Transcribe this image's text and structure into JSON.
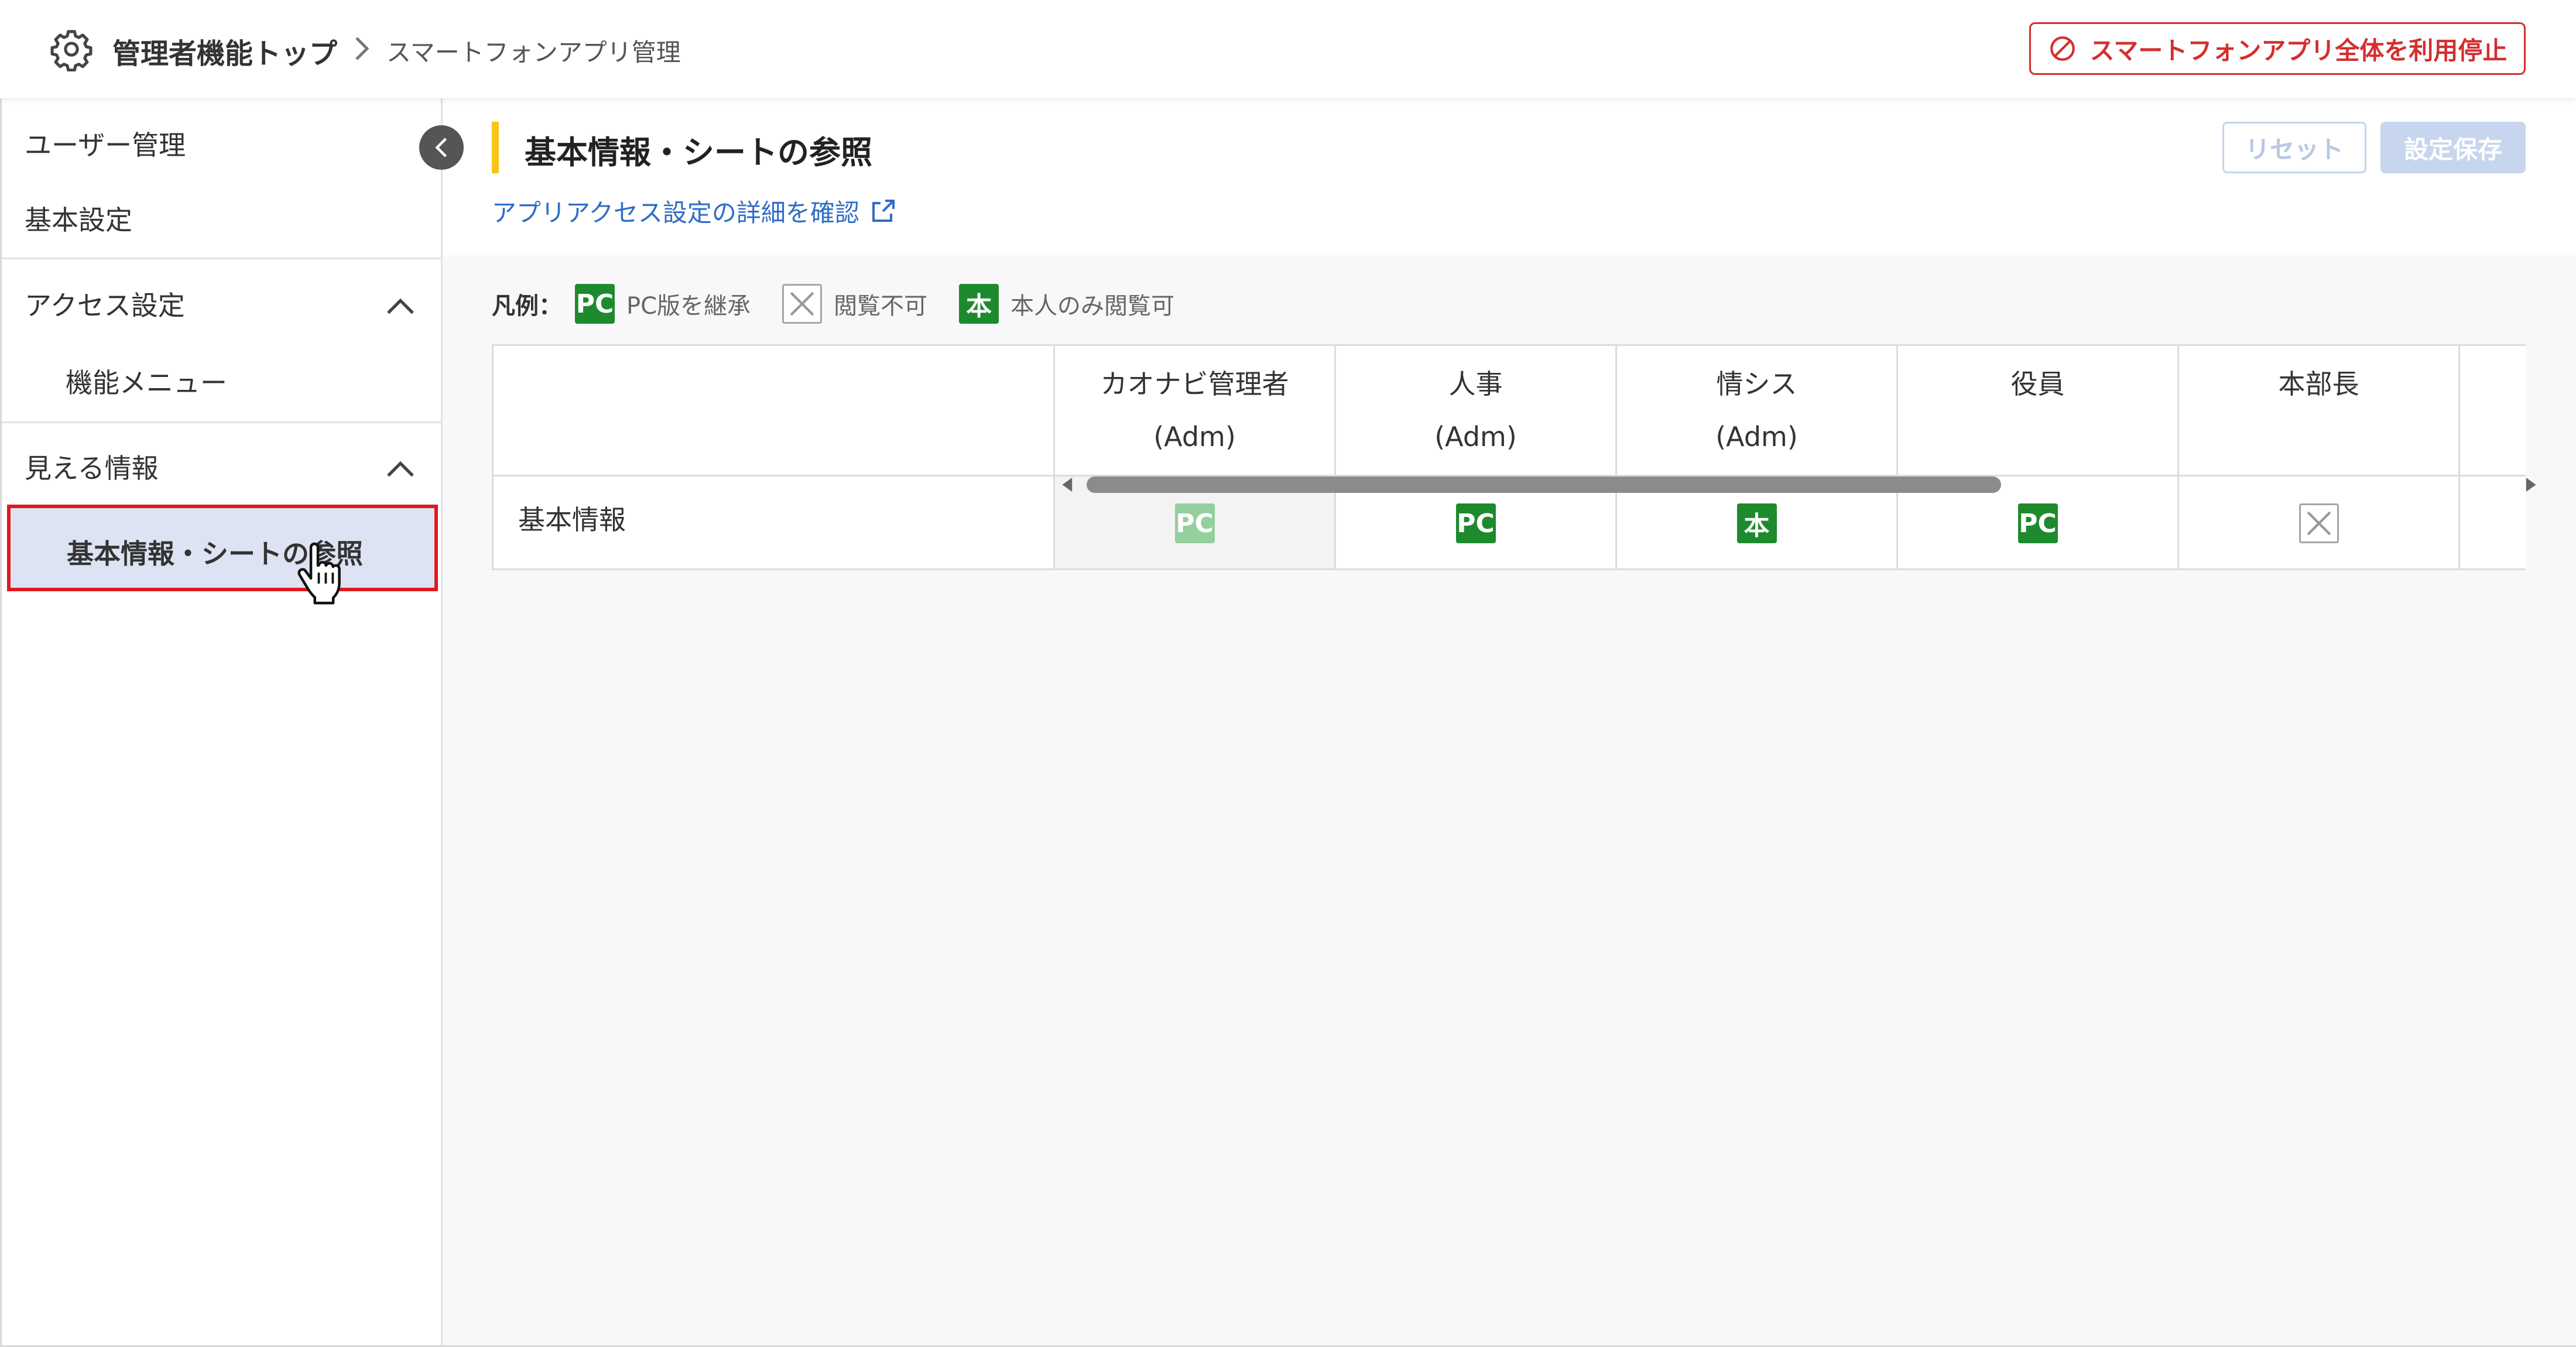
{
  "header": {
    "breadcrumb_top": "管理者機能トップ",
    "breadcrumb_current": "スマートフォンアプリ管理",
    "stop_all_label": "スマートフォンアプリ全体を利用停止"
  },
  "sidebar": {
    "user_management": "ユーザー管理",
    "basic_settings": "基本設定",
    "access_settings": {
      "label": "アクセス設定",
      "items": [
        {
          "label": "機能メニュー"
        }
      ]
    },
    "visible_info": {
      "label": "見える情報",
      "items": [
        {
          "label": "基本情報・シートの参照",
          "selected": true
        }
      ]
    }
  },
  "main": {
    "title": "基本情報・シートの参照",
    "detail_link": "アプリアクセス設定の詳細を確認",
    "reset_label": "リセット",
    "save_label": "設定保存"
  },
  "legend": {
    "title": "凡例：",
    "items": [
      {
        "icon": "pc-badge",
        "badge_text": "PC",
        "label": "PC版を継承"
      },
      {
        "icon": "no-access-x-icon",
        "label": "閲覧不可"
      },
      {
        "icon": "self-only-badge",
        "badge_text": "本",
        "label": "本人のみ閲覧可"
      }
    ]
  },
  "table": {
    "columns": [
      {
        "line1": "カオナビ管理者",
        "line2": "(Adm)"
      },
      {
        "line1": "人事",
        "line2": "(Adm)"
      },
      {
        "line1": "情シス",
        "line2": "(Adm)"
      },
      {
        "line1": "役員",
        "line2": ""
      },
      {
        "line1": "本部長",
        "line2": ""
      }
    ],
    "rows": [
      {
        "label": "基本情報",
        "cells": [
          "PC",
          "PC",
          "本",
          "PC",
          "×"
        ]
      }
    ]
  },
  "colors": {
    "accent_yellow": "#f5c518",
    "danger_red": "#d32f2f",
    "badge_green": "#1e8a2e",
    "badge_green_light": "#94cf9e",
    "link_blue": "#2f6dc6",
    "selected_bg": "#dde3f2",
    "highlight_border": "#e0191f"
  }
}
